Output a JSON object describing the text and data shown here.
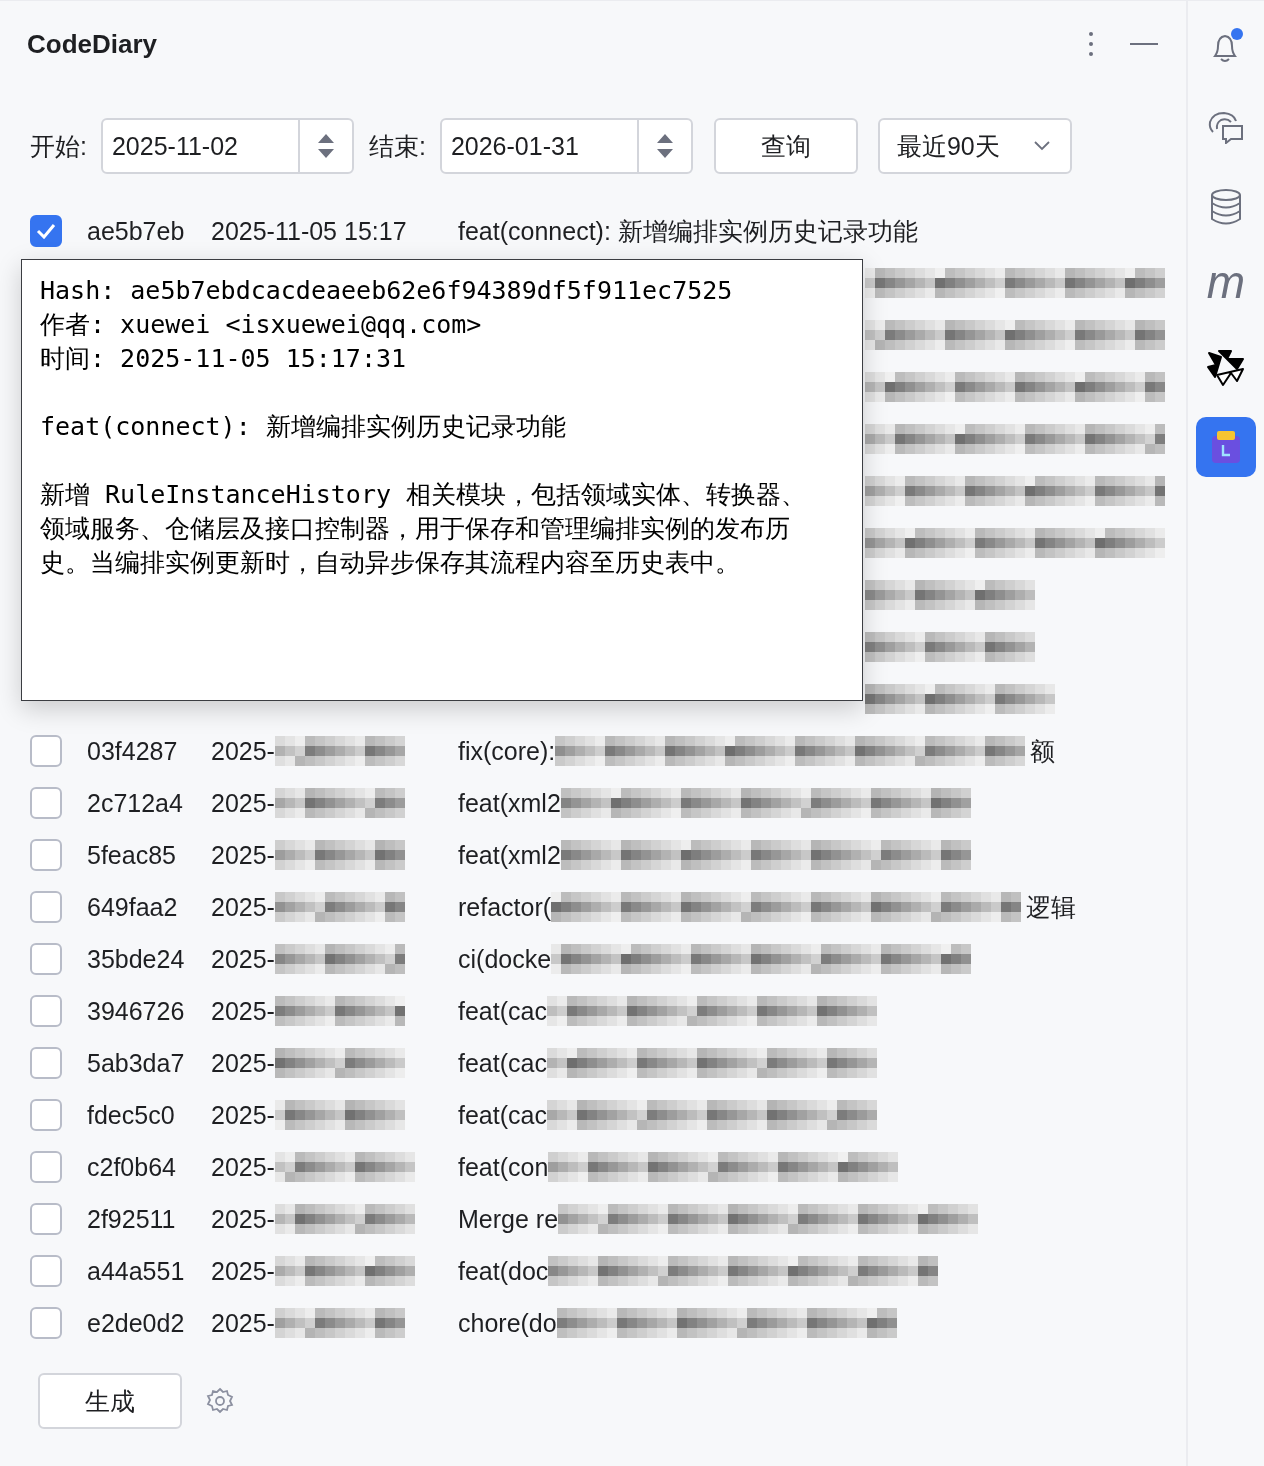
{
  "header": {
    "title": "CodeDiary"
  },
  "filters": {
    "start_label": "开始:",
    "start_value": "2025-11-02",
    "end_label": "结束:",
    "end_value": "2026-01-31",
    "query_button": "查询",
    "range_select": "最近90天"
  },
  "commits": [
    {
      "kind": "full",
      "checked": true,
      "hash": "ae5b7eb",
      "date": "2025-11-05 15:17",
      "message": "feat(connect): 新增编排实例历史记录功能"
    },
    {
      "kind": "covered"
    },
    {
      "kind": "covered"
    },
    {
      "kind": "covered"
    },
    {
      "kind": "covered"
    },
    {
      "kind": "covered"
    },
    {
      "kind": "covered"
    },
    {
      "kind": "covered"
    },
    {
      "kind": "covered"
    },
    {
      "kind": "covered"
    },
    {
      "kind": "blurred",
      "checked": false,
      "hash": "03f4287",
      "date": "2025-",
      "message": "fix(core):",
      "message_end": "额"
    },
    {
      "kind": "blurred",
      "checked": false,
      "hash": "2c712a4",
      "date": "2025-",
      "message": "feat(xml2"
    },
    {
      "kind": "blurred",
      "checked": false,
      "hash": "5feac85",
      "date": "2025-",
      "message": "feat(xml2"
    },
    {
      "kind": "blurred",
      "checked": false,
      "hash": "649faa2",
      "date": "2025-",
      "message": "refactor(",
      "message_end": "逻辑"
    },
    {
      "kind": "blurred",
      "checked": false,
      "hash": "35bde24",
      "date": "2025-",
      "message": "ci(docke"
    },
    {
      "kind": "blurred",
      "checked": false,
      "hash": "3946726",
      "date": "2025-",
      "message": "feat(cac"
    },
    {
      "kind": "blurred",
      "checked": false,
      "hash": "5ab3da7",
      "date": "2025-",
      "message": "feat(cac"
    },
    {
      "kind": "blurred",
      "checked": false,
      "hash": "fdec5c0",
      "date": "2025-",
      "message": "feat(cac"
    },
    {
      "kind": "blurred",
      "checked": false,
      "hash": "c2f0b64",
      "date": "2025-",
      "message": "feat(con"
    },
    {
      "kind": "blurred",
      "checked": false,
      "hash": "2f92511",
      "date": "2025-",
      "message": "Merge re"
    },
    {
      "kind": "blurred",
      "checked": false,
      "hash": "a44a551",
      "date": "2025-",
      "message": "feat(doc"
    },
    {
      "kind": "blurred",
      "checked": false,
      "hash": "e2de0d2",
      "date": "2025-",
      "message": "chore(do"
    }
  ],
  "details_popup": {
    "hash_line": "Hash: ae5b7ebdcacdeaeeb62e6f94389df5f911ec7525",
    "author_line": "作者: xuewei <isxuewei@qq.com>",
    "time_line": "时间: 2025-11-05 15:17:31",
    "subject": "feat(connect): 新增编排实例历史记录功能",
    "body": "新增 RuleInstanceHistory 相关模块，包括领域实体、转换器、领域服务、仓储层及接口控制器，用于保存和管理编排实例的发布历史。当编排实例更新时，自动异步保存其流程内容至历史表中。"
  },
  "footer": {
    "generate_button": "生成"
  },
  "sidebar": [
    {
      "kind": "bell",
      "badge": true,
      "selected": false
    },
    {
      "kind": "chat",
      "selected": false
    },
    {
      "kind": "database",
      "selected": false
    },
    {
      "kind": "letter",
      "label": "m",
      "selected": false
    },
    {
      "kind": "star",
      "selected": false
    },
    {
      "kind": "calendar",
      "selected": true
    }
  ]
}
